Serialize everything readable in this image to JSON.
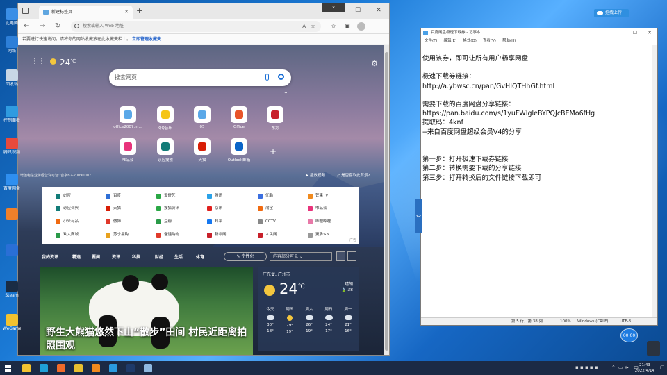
{
  "desktop": {
    "icons": [
      {
        "label": "此电脑",
        "icon": "computer-icon",
        "color": "#3a8ee6"
      },
      {
        "label": "网络",
        "icon": "network-icon",
        "color": "#2d7fd8"
      },
      {
        "label": "回收站",
        "icon": "recycle-bin-icon",
        "color": "#c8d7e6"
      },
      {
        "label": "控制面板",
        "icon": "control-panel-icon",
        "color": "#2f9be0"
      },
      {
        "label": "腾讯视频",
        "icon": "video-app-icon",
        "color": "#e94a3c"
      },
      {
        "label": "百度网盘",
        "icon": "cloud-drive-icon",
        "color": "#2f8ff0"
      },
      {
        "label": "",
        "icon": "office-app-icon",
        "color": "#f0802a"
      },
      {
        "label": "",
        "icon": "blue-app-icon",
        "color": "#2a6fd6"
      },
      {
        "label": "Steam",
        "icon": "steam-icon",
        "color": "#1a2c44"
      },
      {
        "label": "WeGame",
        "icon": "wegame-icon",
        "color": "#f2c230"
      }
    ],
    "upload_button": "拖拽上传",
    "gp_badge": "00:00"
  },
  "browser": {
    "tab_title": "新建标签页",
    "new_tab_symbol": "+",
    "window_controls": {
      "minimize": "—",
      "maximize": "☐",
      "close": "✕"
    },
    "dropdown_symbol": "⌄",
    "address_placeholder": "搜索或输入 Web 地址",
    "favorites_bar_text": "若要进行快速访问，请将你的网站收藏放在此收藏夹栏上。",
    "favorites_bar_link": "立即管理收藏夹",
    "ntp": {
      "weather_temp": "24",
      "weather_unit": "℃",
      "search_placeholder": "搜索网页",
      "quick_links_row1": [
        "office2007.m...",
        "QQ音乐",
        "05",
        "Office",
        "东方"
      ],
      "quick_links_row2": [
        "唯品会",
        "必应搜索",
        "天猫",
        "Outlook邮箱"
      ],
      "quick_link_colors_row1": [
        "#5aa8e8",
        "#f5c518",
        "#5aa8e8",
        "#e8542a",
        "#c8202a"
      ],
      "quick_link_colors_row2": [
        "#e8337b",
        "#127c78",
        "#d81e06",
        "#0a64c8"
      ],
      "icp": "增值电信业务经营许可证: 合字B2-20090007",
      "news_btn_1": "播放视频",
      "news_btn_2": "是否喜欢此背景?",
      "links": [
        [
          "必应",
          "百度",
          "爱奇艺",
          "腾讯",
          "优酷",
          "芒果TV"
        ],
        [
          "必应词典",
          "天猫",
          "搜狐资讯",
          "京东",
          "淘宝",
          "唯品会"
        ],
        [
          "小米有品",
          "微博",
          "豆瓣",
          "知乎",
          "CCTV",
          "哔哩哔哩"
        ],
        [
          "欢太商城",
          "苏宁易购",
          "懂懂购物",
          "新华网",
          "人民网",
          "更多>>"
        ]
      ],
      "link_colors": [
        [
          "#127c78",
          "#2f6fd6",
          "#2aa845",
          "#2aa2e8",
          "#3b6fe0",
          "#f08a1e"
        ],
        [
          "#127c78",
          "#d81e06",
          "#2aa845",
          "#e0201e",
          "#f06a10",
          "#e8337b"
        ],
        [
          "#f06a10",
          "#e0382a",
          "#2a9a48",
          "#1678f0",
          "#888888",
          "#e879a8"
        ],
        [
          "#2a9a48",
          "#e8a21e",
          "#e03a2a",
          "#c8202a",
          "#c8202a",
          "#999999"
        ]
      ],
      "ad_tag": "广告",
      "feed_tabs": [
        "我的资讯",
        "精选",
        "要闻",
        "资讯",
        "科技",
        "财经",
        "生活",
        "体育"
      ],
      "personalize": "个性化",
      "visibility": "内容部分可见",
      "headline": "野生大熊猫悠然下山“散步”田间 村民近距离拍照围观",
      "weather_card": {
        "location": "广东省, 广州市",
        "temp": "24",
        "unit": "℃",
        "condition": "晴朗",
        "aqi": "38",
        "days": [
          {
            "name": "今天",
            "hi": "30°",
            "lo": "18°",
            "sun": false
          },
          {
            "name": "周五",
            "hi": "29°",
            "lo": "19°",
            "sun": true
          },
          {
            "name": "周六",
            "hi": "26°",
            "lo": "19°",
            "sun": false
          },
          {
            "name": "周日",
            "hi": "24°",
            "lo": "17°",
            "sun": false
          },
          {
            "name": "周一",
            "hi": "21°",
            "lo": "16°",
            "sun": false
          }
        ]
      }
    }
  },
  "notepad": {
    "title": "百度网盘极速下载券 - 记事本",
    "menus": [
      "文件(F)",
      "编辑(E)",
      "格式(O)",
      "查看(V)",
      "帮助(H)"
    ],
    "content": "使用该券，即可让所有用户畅享网盘\n\n极速下载券链接：\nhttp://a.ybwsc.cn/pan/GvHIQTHhGf.html\n\n需要下载的百度网盘分享链接：\nhttps://pan.baidu.com/s/1yuFWIgleBYPQJcBEMo6fHg\n提取码：4knf\n--来自百度网盘超级会员V4的分享\n\n\n第一步：打开极速下载券链接\n第二步：转换需要下载的分享链接\n第三步：打开转换后的文件链接下载即可",
    "status_pos": "第 5 行，第 38 列",
    "status_zoom": "100%",
    "status_eol": "Windows (CRLF)",
    "status_enc": "UTF-8"
  },
  "taskbar": {
    "time": "21:43",
    "date": "2022/4/14",
    "ime": "中",
    "apps": [
      {
        "icon": "file-explorer-icon",
        "color": "#f2c230"
      },
      {
        "icon": "edge-icon",
        "color": "#1fa0d8"
      },
      {
        "icon": "firefox-icon",
        "color": "#f06a2a"
      },
      {
        "icon": "chrome-icon",
        "color": "#e8c030"
      },
      {
        "icon": "app-orange-icon",
        "color": "#f08a1e"
      },
      {
        "icon": "qq-browser-icon",
        "color": "#2a9ae0"
      },
      {
        "icon": "photoshop-icon",
        "color": "#1e3a6a"
      },
      {
        "icon": "notepad-icon",
        "color": "#8fb8e0"
      }
    ]
  }
}
